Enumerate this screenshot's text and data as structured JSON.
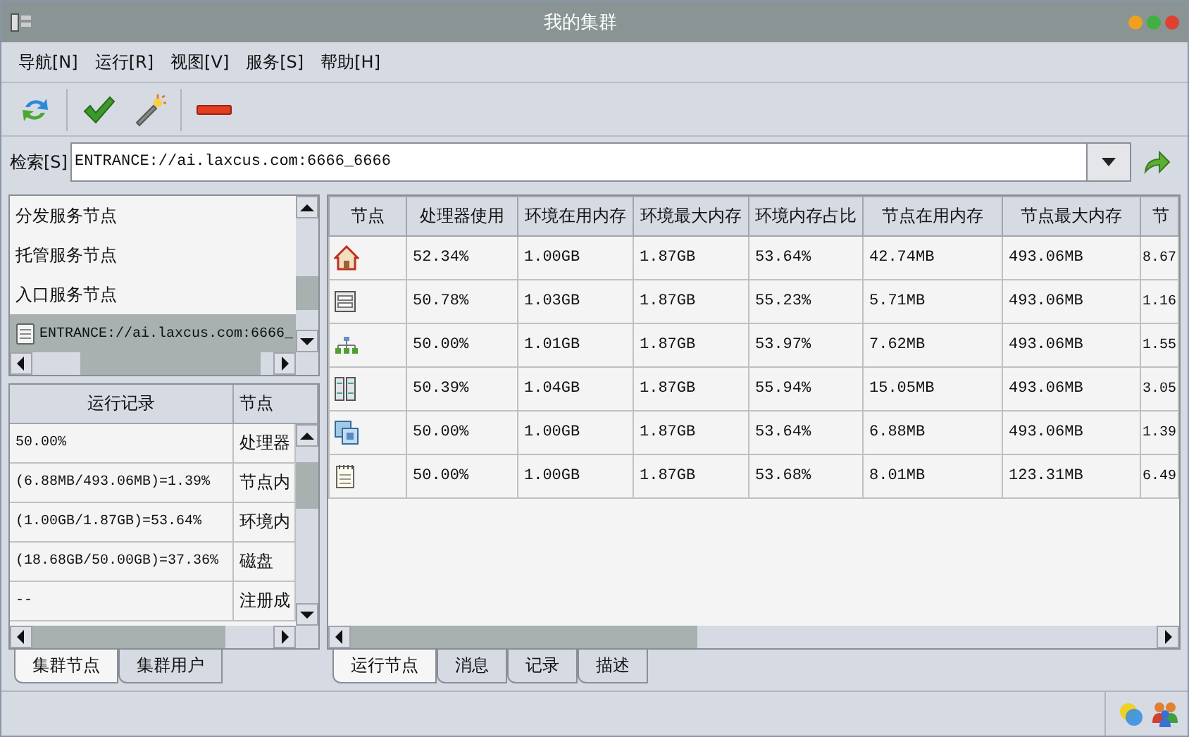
{
  "window": {
    "title": "我的集群"
  },
  "menu": [
    "导航[N]",
    "运行[R]",
    "视图[V]",
    "服务[S]",
    "帮助[H]"
  ],
  "search": {
    "label": "检索[S]",
    "value": "ENTRANCE://ai.laxcus.com:6666_6666"
  },
  "node_list": {
    "items": [
      {
        "label": "分发服务节点",
        "selected": false
      },
      {
        "label": "托管服务节点",
        "selected": false
      },
      {
        "label": "入口服务节点",
        "selected": false
      },
      {
        "label": "ENTRANCE://ai.laxcus.com:6666_",
        "selected": true
      }
    ]
  },
  "record_table": {
    "columns": [
      "运行记录",
      "节点"
    ],
    "rows": [
      [
        "50.00%",
        "处理器"
      ],
      [
        "(6.88MB/493.06MB)=1.39%",
        "节点内"
      ],
      [
        "(1.00GB/1.87GB)=53.64%",
        "环境内"
      ],
      [
        "(18.68GB/50.00GB)=37.36%",
        "磁盘"
      ],
      [
        "--",
        "注册成"
      ]
    ]
  },
  "left_tabs": [
    {
      "label": "集群节点",
      "selected": true
    },
    {
      "label": "集群用户",
      "selected": false
    }
  ],
  "node_table": {
    "columns": [
      "节点",
      "处理器使用",
      "环境在用内存",
      "环境最大内存",
      "环境内存占比",
      "节点在用内存",
      "节点最大内存",
      "节"
    ],
    "rows": [
      [
        "",
        "52.34%",
        "1.00GB",
        "1.87GB",
        "53.64%",
        "42.74MB",
        "493.06MB",
        "8.67"
      ],
      [
        "",
        "50.78%",
        "1.03GB",
        "1.87GB",
        "55.23%",
        "5.71MB",
        "493.06MB",
        "1.16"
      ],
      [
        "",
        "50.00%",
        "1.01GB",
        "1.87GB",
        "53.97%",
        "7.62MB",
        "493.06MB",
        "1.55"
      ],
      [
        "",
        "50.39%",
        "1.04GB",
        "1.87GB",
        "55.94%",
        "15.05MB",
        "493.06MB",
        "3.05"
      ],
      [
        "",
        "50.00%",
        "1.00GB",
        "1.87GB",
        "53.64%",
        "6.88MB",
        "493.06MB",
        "1.39"
      ],
      [
        "",
        "50.00%",
        "1.00GB",
        "1.87GB",
        "53.68%",
        "8.01MB",
        "123.31MB",
        "6.49"
      ]
    ]
  },
  "right_tabs": [
    {
      "label": "运行节点",
      "selected": true
    },
    {
      "label": "消息",
      "selected": false
    },
    {
      "label": "记录",
      "selected": false
    },
    {
      "label": "描述",
      "selected": false
    }
  ]
}
